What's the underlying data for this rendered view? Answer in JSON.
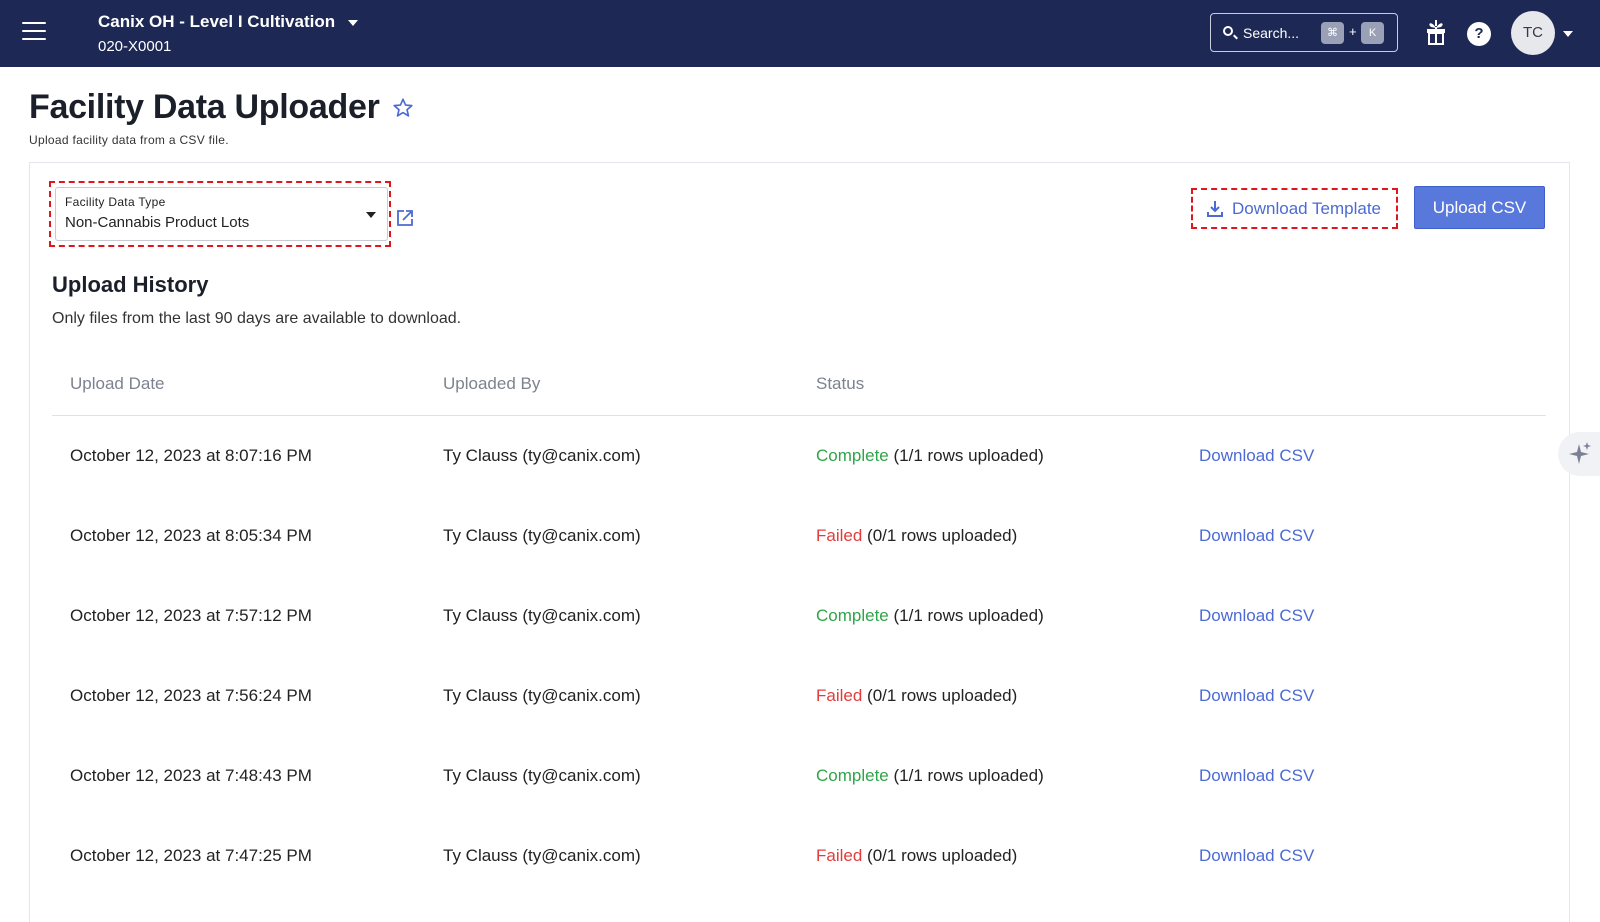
{
  "topbar": {
    "facility_name": "Canix OH - Level I Cultivation",
    "facility_id": "020-X0001",
    "search_placeholder": "Search...",
    "shortcut_key_1": "⌘",
    "shortcut_plus": "+",
    "shortcut_key_2": "K",
    "help_glyph": "?",
    "avatar_initials": "TC",
    "icons": [
      "hamburger-menu-icon",
      "search-icon",
      "gift-icon",
      "help-icon",
      "chevron-down-icon"
    ]
  },
  "page": {
    "title": "Facility Data Uploader",
    "subtitle": "Upload facility data from a CSV file."
  },
  "controls": {
    "select_label": "Facility Data Type",
    "select_value": "Non-Cannabis Product Lots",
    "download_template_label": "Download Template",
    "upload_csv_label": "Upload CSV"
  },
  "history": {
    "title": "Upload History",
    "note": "Only files from the last 90 days are available to download.",
    "columns": [
      "Upload Date",
      "Uploaded By",
      "Status"
    ],
    "rows": [
      {
        "date": "October 12, 2023 at 8:07:16 PM",
        "by": "Ty Clauss (ty@canix.com)",
        "status": "Complete",
        "detail": "(1/1 rows uploaded)",
        "link": "Download CSV"
      },
      {
        "date": "October 12, 2023 at 8:05:34 PM",
        "by": "Ty Clauss (ty@canix.com)",
        "status": "Failed",
        "detail": "(0/1 rows uploaded)",
        "link": "Download CSV"
      },
      {
        "date": "October 12, 2023 at 7:57:12 PM",
        "by": "Ty Clauss (ty@canix.com)",
        "status": "Complete",
        "detail": "(1/1 rows uploaded)",
        "link": "Download CSV"
      },
      {
        "date": "October 12, 2023 at 7:56:24 PM",
        "by": "Ty Clauss (ty@canix.com)",
        "status": "Failed",
        "detail": "(0/1 rows uploaded)",
        "link": "Download CSV"
      },
      {
        "date": "October 12, 2023 at 7:48:43 PM",
        "by": "Ty Clauss (ty@canix.com)",
        "status": "Complete",
        "detail": "(1/1 rows uploaded)",
        "link": "Download CSV"
      },
      {
        "date": "October 12, 2023 at 7:47:25 PM",
        "by": "Ty Clauss (ty@canix.com)",
        "status": "Failed",
        "detail": "(0/1 rows uploaded)",
        "link": "Download CSV"
      }
    ]
  },
  "colors": {
    "nav_bg": "#1d2855",
    "accent": "#4c6ad5",
    "button_bg": "#5878dc",
    "status_complete": "#2fa548",
    "status_failed": "#e23c3c",
    "annotation_dashed": "#e0161f"
  }
}
